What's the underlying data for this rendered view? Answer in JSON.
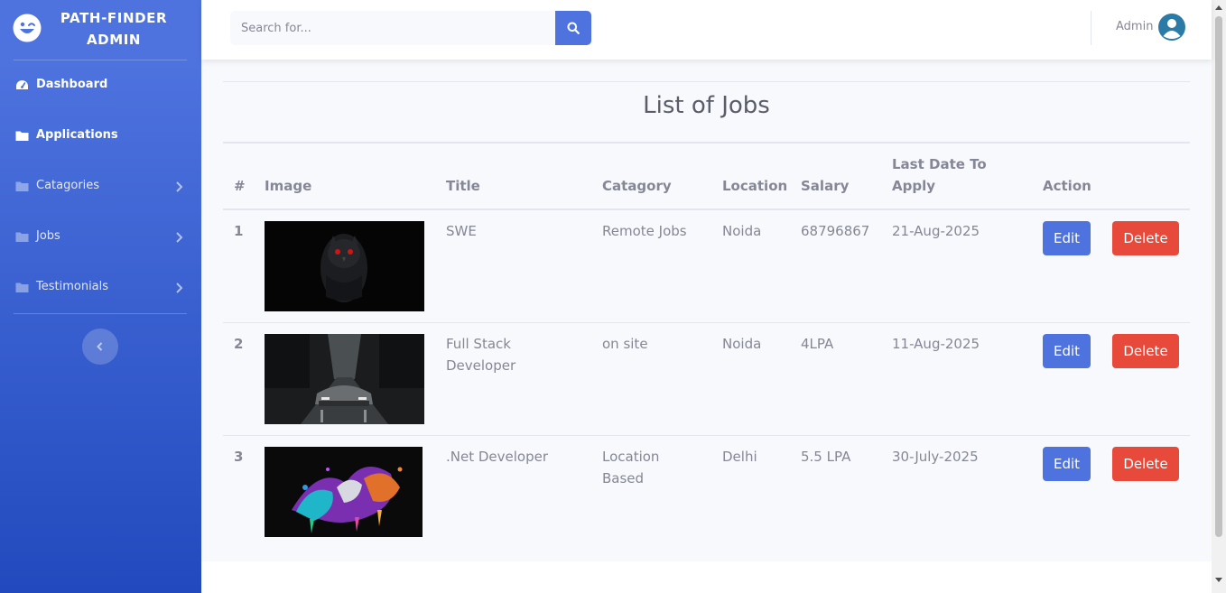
{
  "brand": {
    "name": "PATH-FINDER ADMIN",
    "icon": "laugh-wink-icon"
  },
  "sidebar": {
    "items": [
      {
        "label": "Dashboard",
        "icon": "tachometer-icon",
        "active": true
      },
      {
        "label": "Applications",
        "icon": "folder-icon",
        "active": true
      },
      {
        "label": "Catagories",
        "icon": "folder-icon",
        "has_submenu": true
      },
      {
        "label": "Jobs",
        "icon": "folder-icon",
        "has_submenu": true
      },
      {
        "label": "Testimonials",
        "icon": "folder-icon",
        "has_submenu": true
      }
    ],
    "toggle_icon": "chevron-left-icon"
  },
  "topbar": {
    "search_placeholder": "Search for...",
    "search_icon": "search-icon",
    "user_name": "Admin",
    "avatar_icon": "user-avatar-icon"
  },
  "main": {
    "title": "List of Jobs",
    "table": {
      "headers": [
        "#",
        "Image",
        "Title",
        "Catagory",
        "Location",
        "Salary",
        "Last Date To Apply",
        "Action"
      ],
      "rows": [
        {
          "num": "1",
          "image": "dark owl with red eyes",
          "title": "SWE",
          "category": "Remote Jobs",
          "location": "Noida",
          "salary": "68796867",
          "last_date": "21-Aug-2025",
          "edit": "Edit",
          "delete": "Delete"
        },
        {
          "num": "2",
          "image": "sports car on forest road",
          "title": "Full Stack Developer",
          "category": "on site",
          "location": "Noida",
          "salary": "4LPA",
          "last_date": "11-Aug-2025",
          "edit": "Edit",
          "delete": "Delete"
        },
        {
          "num": "3",
          "image": "colorful paint splash",
          "title": ".Net Developer",
          "category": "Location Based",
          "location": "Delhi",
          "salary": "5.5 LPA",
          "last_date": "30-July-2025",
          "edit": "Edit",
          "delete": "Delete"
        }
      ]
    }
  },
  "colors": {
    "sidebar_top": "#4e73df",
    "sidebar_bottom": "#224abe",
    "primary": "#4e73df",
    "danger": "#e74a3b",
    "content_bg": "#f8f9fc",
    "text": "#858796"
  }
}
